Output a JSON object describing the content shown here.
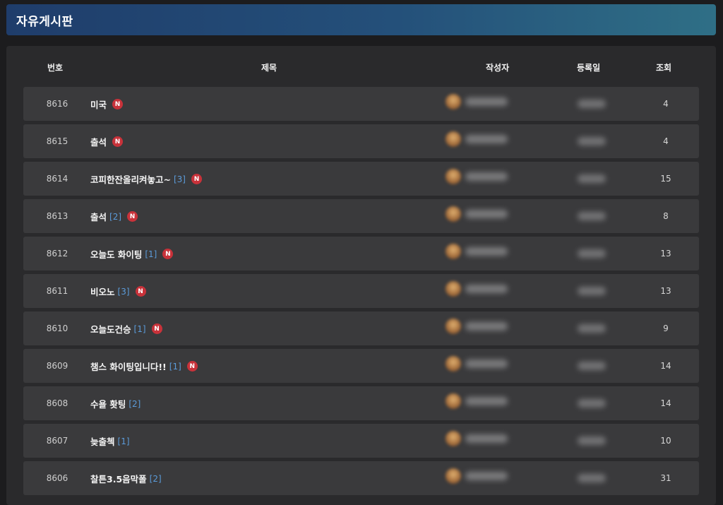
{
  "board": {
    "title": "자유게시판"
  },
  "columns": {
    "num": "번호",
    "title": "제목",
    "writer": "작성자",
    "date": "등록일",
    "views": "조회"
  },
  "new_badge_label": "N",
  "colors": {
    "header_start": "#1f3d6b",
    "header_end": "#2f6f86",
    "new_badge": "#c8323a",
    "comment_count": "#5b9bd9"
  },
  "posts": [
    {
      "num": "8616",
      "title": "미국",
      "comments": "",
      "is_new": true,
      "views": "4"
    },
    {
      "num": "8615",
      "title": "출석",
      "comments": "",
      "is_new": true,
      "views": "4"
    },
    {
      "num": "8614",
      "title": "코피한잔올리켜놓고~",
      "comments": "[3]",
      "is_new": true,
      "views": "15"
    },
    {
      "num": "8613",
      "title": "출석",
      "comments": "[2]",
      "is_new": true,
      "views": "8"
    },
    {
      "num": "8612",
      "title": "오늘도 화이팅",
      "comments": "[1]",
      "is_new": true,
      "views": "13"
    },
    {
      "num": "8611",
      "title": "비오노",
      "comments": "[3]",
      "is_new": true,
      "views": "13"
    },
    {
      "num": "8610",
      "title": "오늘도건승",
      "comments": "[1]",
      "is_new": true,
      "views": "9"
    },
    {
      "num": "8609",
      "title": "챔스 화이팅입니다!!",
      "comments": "[1]",
      "is_new": true,
      "views": "14"
    },
    {
      "num": "8608",
      "title": "수욜 홧팅",
      "comments": "[2]",
      "is_new": false,
      "views": "14"
    },
    {
      "num": "8607",
      "title": "늦출첵",
      "comments": "[1]",
      "is_new": false,
      "views": "10"
    },
    {
      "num": "8606",
      "title": "찰튼3.5음막폴",
      "comments": "[2]",
      "is_new": false,
      "views": "31"
    }
  ]
}
